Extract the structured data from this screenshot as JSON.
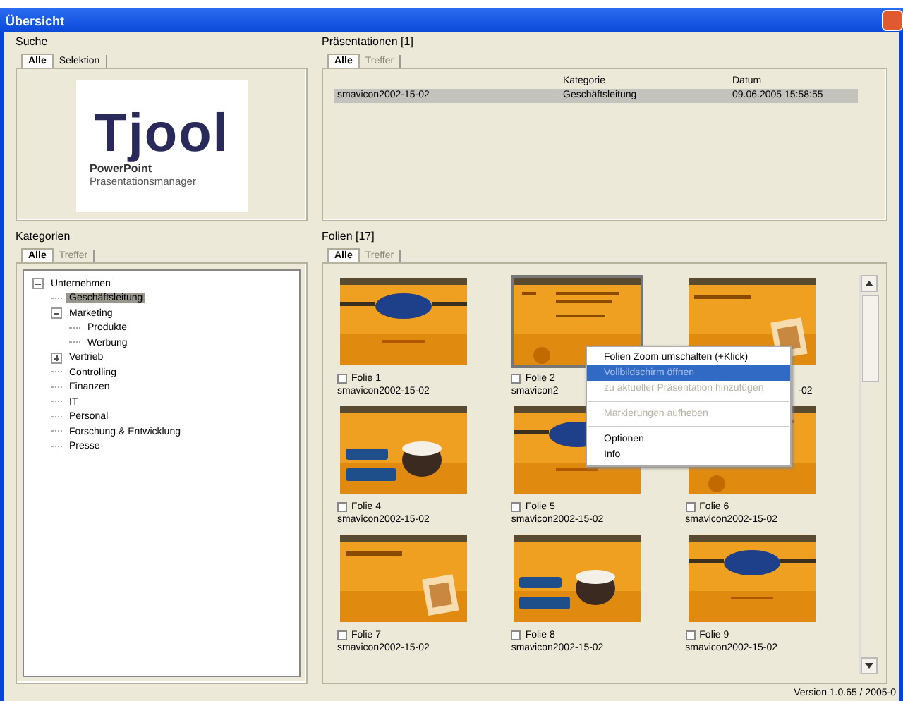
{
  "window": {
    "title": "Übersicht"
  },
  "search": {
    "title": "Suche",
    "tabs": [
      {
        "label": "Alle",
        "selected": true,
        "disabled": false
      },
      {
        "label": "Selektion",
        "selected": false,
        "disabled": false
      }
    ],
    "logo": {
      "name": "Tjool",
      "line_1": "PowerPoint",
      "line_2": "Präsentationsmanager"
    }
  },
  "presentations": {
    "title": "Präsentationen [1]",
    "tabs": [
      {
        "label": "Alle",
        "selected": true,
        "disabled": false
      },
      {
        "label": "Treffer",
        "selected": false,
        "disabled": true
      }
    ],
    "columns": [
      "Kategorie",
      "Datum"
    ],
    "rows": [
      {
        "name": "smavicon2002-15-02",
        "category": "Geschäftsleitung",
        "date": "09.06.2005 15:58:55",
        "selected": true
      }
    ]
  },
  "categories": {
    "title": "Kategorien",
    "tabs": [
      {
        "label": "Alle",
        "selected": true,
        "disabled": false
      },
      {
        "label": "Treffer",
        "selected": false,
        "disabled": true
      }
    ],
    "tree": [
      {
        "label": "Unternehmen",
        "selected": false,
        "expanded": true,
        "children": [
          {
            "label": "Geschäftsleitung",
            "selected": true
          },
          {
            "label": "Marketing",
            "selected": false,
            "expanded": true,
            "children": [
              {
                "label": "Produkte",
                "selected": false
              },
              {
                "label": "Werbung",
                "selected": false
              }
            ]
          },
          {
            "label": "Vertrieb",
            "selected": false,
            "expanded": false
          },
          {
            "label": "Controlling",
            "selected": false
          },
          {
            "label": "Finanzen",
            "selected": false
          },
          {
            "label": "IT",
            "selected": false
          },
          {
            "label": "Personal",
            "selected": false
          },
          {
            "label": "Forschung & Entwicklung",
            "selected": false
          },
          {
            "label": "Presse",
            "selected": false
          }
        ]
      }
    ]
  },
  "slides": {
    "title": "Folien [17]",
    "tabs": [
      {
        "label": "Alle",
        "selected": true,
        "disabled": false
      },
      {
        "label": "Treffer",
        "selected": false,
        "disabled": true
      }
    ],
    "items": [
      {
        "label": "Folie 1",
        "name": "smavicon2002-15-02",
        "checked": false,
        "selected": false
      },
      {
        "label": "Folie 2",
        "name": "smavicon2",
        "checked": false,
        "selected": true
      },
      {
        "name": "-02",
        "selected": false
      },
      {
        "label": "Folie 4",
        "name": "smavicon2002-15-02",
        "checked": false,
        "selected": false
      },
      {
        "label": "Folie 5",
        "name": "smavicon2002-15-02",
        "checked": false,
        "selected": false
      },
      {
        "label": "Folie 6",
        "name": "smavicon2002-15-02",
        "checked": false,
        "selected": false
      },
      {
        "label": "Folie 7",
        "name": "smavicon2002-15-02",
        "checked": false,
        "selected": false
      },
      {
        "label": "Folie 8",
        "name": "smavicon2002-15-02",
        "checked": false,
        "selected": false
      },
      {
        "label": "Folie 9",
        "name": "smavicon2002-15-02",
        "checked": false,
        "selected": false
      }
    ]
  },
  "context_menu": {
    "items": [
      {
        "kind": "item",
        "label": "Folien Zoom umschalten (+Klick)",
        "disabled": false,
        "selected": false
      },
      {
        "kind": "item",
        "label": "Vollbildschirm öffnen",
        "disabled": false,
        "selected": true
      },
      {
        "kind": "item",
        "label": "zu aktueller Präsentation hinzufügen",
        "disabled": true,
        "selected": false
      },
      {
        "kind": "separator"
      },
      {
        "kind": "item",
        "label": "Markierungen aufheben",
        "disabled": true,
        "selected": false
      },
      {
        "kind": "separator"
      },
      {
        "kind": "item",
        "label": "Optionen",
        "disabled": false,
        "selected": false
      },
      {
        "kind": "item",
        "label": "Info",
        "disabled": false,
        "selected": false
      }
    ]
  },
  "status_bar": {
    "text": "Version 1.0.65 / 2005-0"
  }
}
